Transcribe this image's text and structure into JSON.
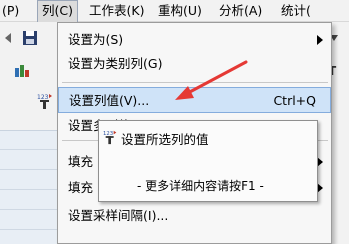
{
  "menubar": {
    "items": [
      {
        "label": "(P)"
      },
      {
        "label": "列(C)"
      },
      {
        "label": "工作表(K)"
      },
      {
        "label": "重构(U)"
      },
      {
        "label": "分析(A)"
      },
      {
        "label": "统计("
      }
    ]
  },
  "column_menu": {
    "items": [
      {
        "label": "设置为(S)",
        "submenu": true
      },
      {
        "label": "设置为类别列(G)"
      },
      {
        "label": "设置列值(V)...",
        "shortcut": "Ctrl+Q",
        "highlighted": true
      },
      {
        "label": "设置多列值"
      },
      {
        "label": "填充",
        "submenu": true
      },
      {
        "label": "填充",
        "submenu": true
      },
      {
        "label": "设置采样间隔(I)..."
      }
    ]
  },
  "tooltip": {
    "title": "设置所选列的值",
    "hint": "- 更多详细内容请按F1 -"
  },
  "colors": {
    "highlight_bg": "#cfe3f8",
    "highlight_border": "#84acdd",
    "annotation_arrow": "#e53935"
  }
}
